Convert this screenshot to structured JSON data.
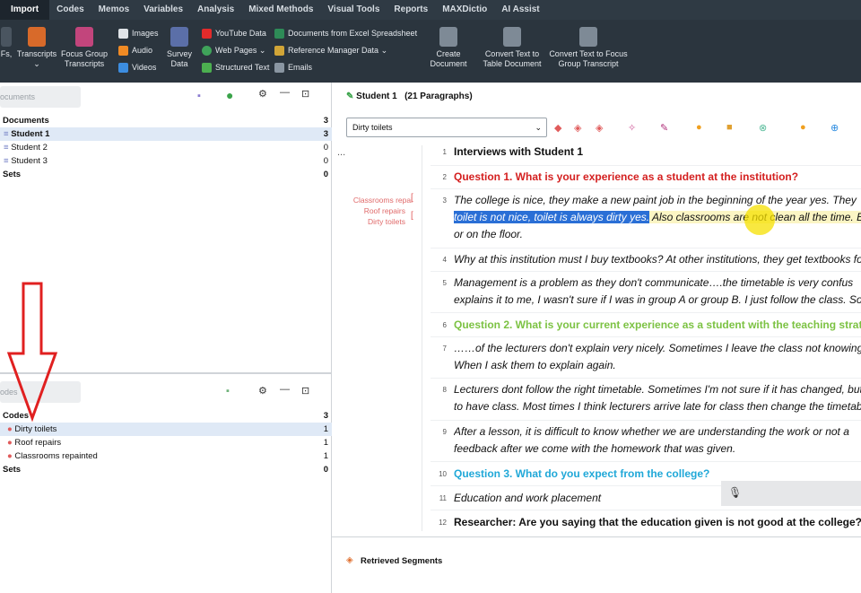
{
  "menu": [
    "Import",
    "Codes",
    "Memos",
    "Variables",
    "Analysis",
    "Mixed Methods",
    "Visual Tools",
    "Reports",
    "MAXDictio",
    "AI Assist"
  ],
  "ribbon": {
    "pdfs_label": "Fs,",
    "transcripts": "Transcripts",
    "focus_group_1": "Focus Group",
    "focus_group_2": "Transcripts",
    "images": "Images",
    "audio": "Audio",
    "videos": "Videos",
    "survey_1": "Survey",
    "survey_2": "Data",
    "youtube": "YouTube Data",
    "webpages": "Web Pages",
    "structured": "Structured Text",
    "excel": "Documents from Excel Spreadsheet",
    "refman": "Reference Manager Data",
    "emails": "Emails",
    "create_1": "Create",
    "create_2": "Document",
    "convert_table_1": "Convert Text to",
    "convert_table_2": "Table Document",
    "convert_focus_1": "Convert Text to Focus",
    "convert_focus_2": "Group Transcript"
  },
  "left": {
    "doc_search_placeholder": "ocuments",
    "documents": {
      "label": "Documents",
      "count": "3"
    },
    "doc_items": [
      {
        "label": "Student 1",
        "count": "3"
      },
      {
        "label": "Student 2",
        "count": "0"
      },
      {
        "label": "Student 3",
        "count": "0"
      }
    ],
    "doc_sets": {
      "label": "Sets",
      "count": "0"
    },
    "code_search_placeholder": "odes",
    "codes": {
      "label": "Codes",
      "count": "3"
    },
    "code_items": [
      {
        "label": "Dirty toilets",
        "count": "1",
        "color": "#e05b5b"
      },
      {
        "label": "Roof repairs",
        "count": "1",
        "color": "#e05b5b"
      },
      {
        "label": "Classrooms repainted",
        "count": "1",
        "color": "#e05b5b"
      }
    ],
    "code_sets": {
      "label": "Sets",
      "count": "0"
    }
  },
  "right": {
    "doc_title": "Student 1",
    "para_count": "(21 Paragraphs)",
    "code_dropdown": "Dirty toilets",
    "code_labels": [
      "Classrooms repai",
      "Roof repairs",
      "Dirty toilets"
    ],
    "ellipsis": "...",
    "paragraphs": [
      {
        "n": "1",
        "lines": [
          "Interviews with Student 1"
        ]
      },
      {
        "n": "2",
        "lines": [
          "Question 1. What is your experience as a student at the institution?"
        ]
      },
      {
        "n": "3",
        "lines": [
          "The college is nice, they make a new paint job in the beginning of the year yes. They",
          "toilet is not nice, toilet is always dirty yes.",
          " Also classrooms are not clean all the time. B",
          "or on the floor."
        ]
      },
      {
        "n": "4",
        "lines": [
          "Why at this institution must I buy textbooks? At other institutions, they get textbooks for"
        ]
      },
      {
        "n": "5",
        "lines": [
          " Management is a problem as they don't communicate….the timetable is very confus",
          "explains it to me, I wasn't sure if I was in group A or group B. I just follow the class. Som"
        ]
      },
      {
        "n": "6",
        "lines": [
          "Question 2. What is your current experience as a student with the teaching strate"
        ]
      },
      {
        "n": "7",
        "lines": [
          "……of the lecturers don't explain very nicely. Sometimes I leave the class not knowing",
          "When I ask them to explain again."
        ]
      },
      {
        "n": "8",
        "lines": [
          "Lecturers dont follow the right timetable. Sometimes I'm not sure if it has changed, but",
          "to have class. Most times I think lecturers arrive late for class then change the timetabl"
        ]
      },
      {
        "n": "9",
        "lines": [
          "After a lesson, it is difficult to know whether we are understanding the work or not a",
          "feedback after we come with the homework that was given."
        ]
      },
      {
        "n": "10",
        "lines": [
          "Question 3. What do you expect from the college?"
        ]
      },
      {
        "n": "11",
        "lines": [
          "Education and work placement"
        ]
      },
      {
        "n": "12",
        "lines": [
          "Researcher: Are you saying that the education given is not good at the college?"
        ]
      }
    ],
    "retrieved": "Retrieved Segments"
  }
}
